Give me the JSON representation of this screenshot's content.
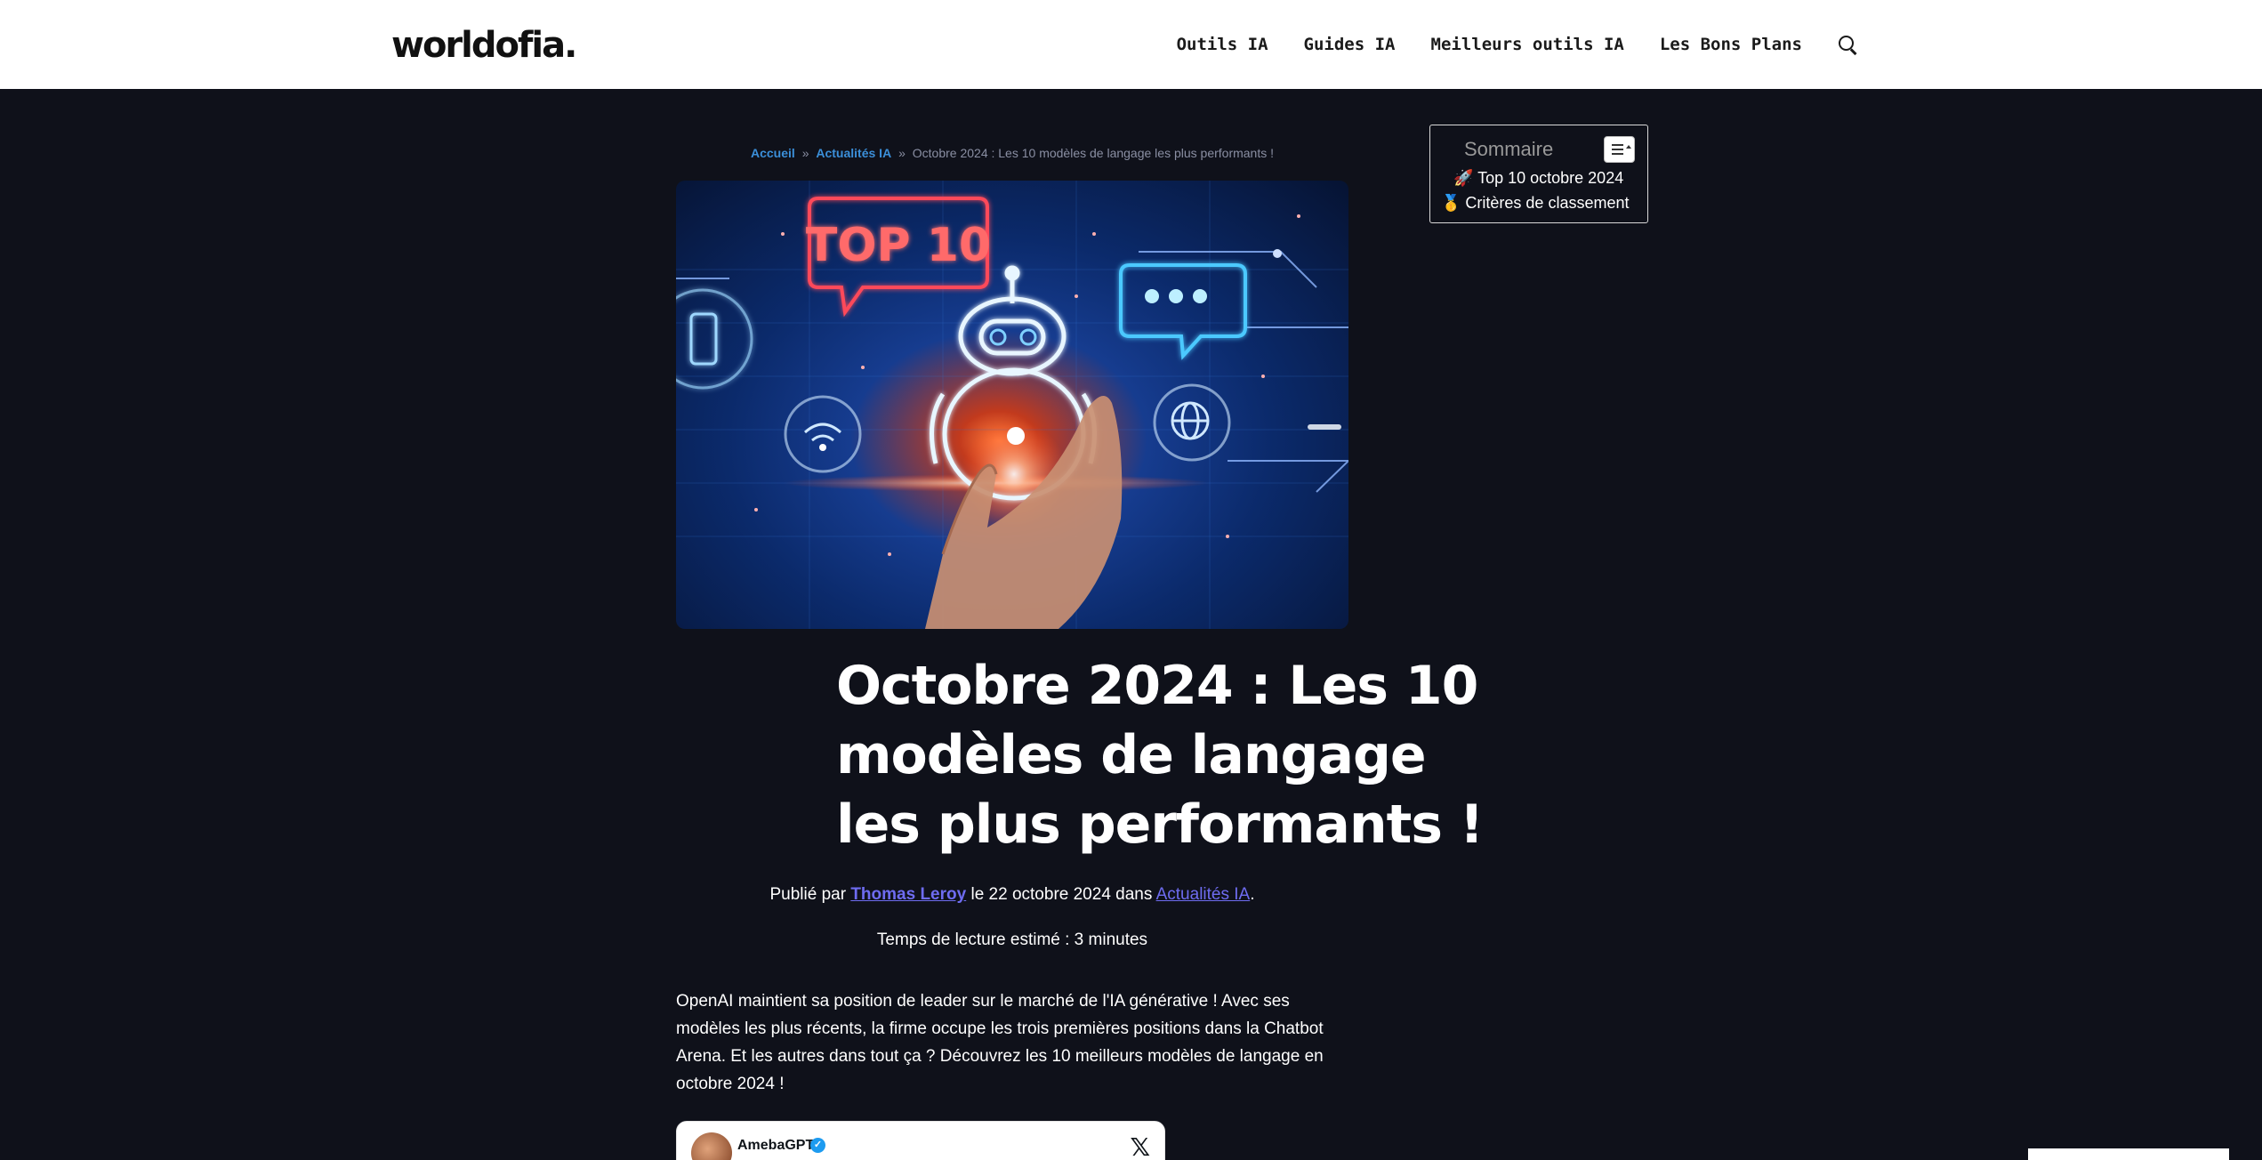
{
  "header": {
    "logo": "worldofia.",
    "nav": [
      "Outils IA",
      "Guides IA",
      "Meilleurs outils IA",
      "Les Bons Plans"
    ]
  },
  "breadcrumb": {
    "home": "Accueil",
    "separator": "»",
    "category": "Actualités IA",
    "current": "Octobre 2024 : Les 10 modèles de langage les plus performants !"
  },
  "hero": {
    "badge_text": "TOP 10"
  },
  "article": {
    "title_lines": [
      "Octobre 2024 : Les 10",
      "modèles de langage",
      "les plus performants !"
    ],
    "byline": {
      "prefix": "Publié par",
      "author": "Thomas Leroy",
      "date_text": "le 22 octobre 2024 dans",
      "category": "Actualités IA",
      "suffix": "."
    },
    "reading_time": "Temps de lecture estimé : 3 minutes",
    "intro": "OpenAI maintient sa position de leader sur le marché de l'IA générative ! Avec ses modèles les plus récents, la firme occupe les trois premières positions dans la Chatbot Arena. Et les autres dans tout ça ? Découvrez les 10 meilleurs modèles de langage en octobre 2024 !"
  },
  "tweet": {
    "name": "AmebaGPT",
    "verified_mark": "✓",
    "x_logo": "𝕏"
  },
  "toc": {
    "title": "Sommaire",
    "items": [
      "🚀 Top 10 octobre 2024",
      "🥇 Critères de classement"
    ]
  },
  "colors": {
    "background": "#0f111a",
    "link": "#6e6cf0",
    "breadcrumb_link": "#3b8fd9"
  }
}
